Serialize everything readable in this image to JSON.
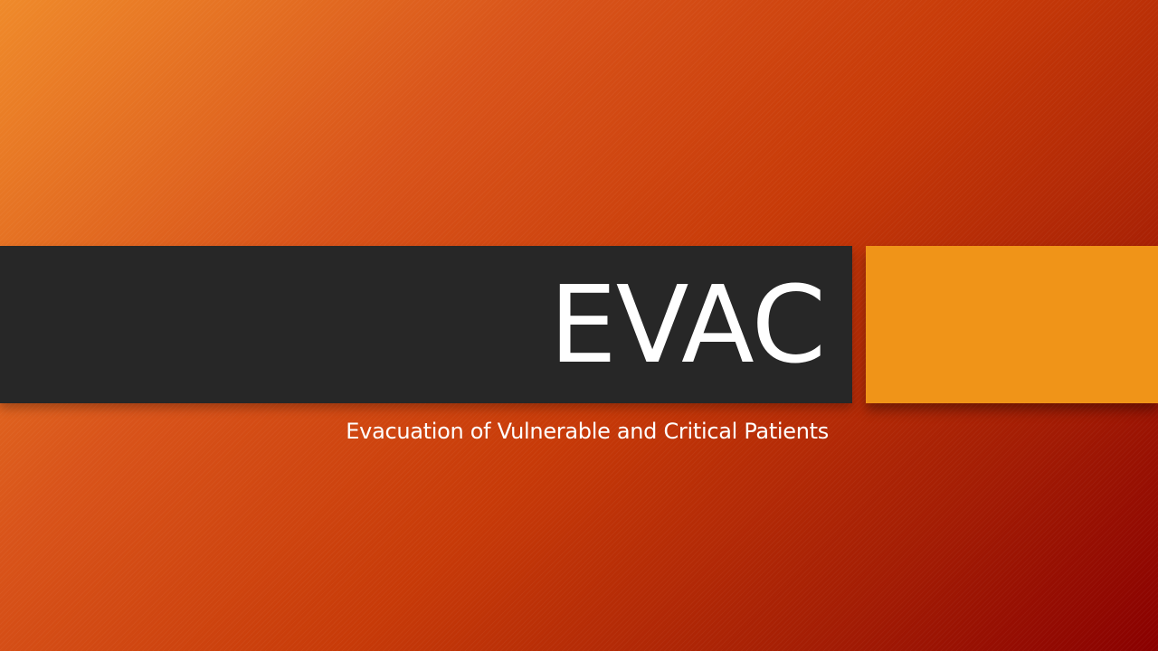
{
  "slide": {
    "title": "EVAC",
    "subtitle": "Evacuation of Vulnerable and Critical Patients"
  },
  "colors": {
    "background_start": "#ef8a2a",
    "background_end": "#8a0000",
    "title_band": "#272727",
    "accent_block": "#f09418",
    "text": "#ffffff"
  }
}
